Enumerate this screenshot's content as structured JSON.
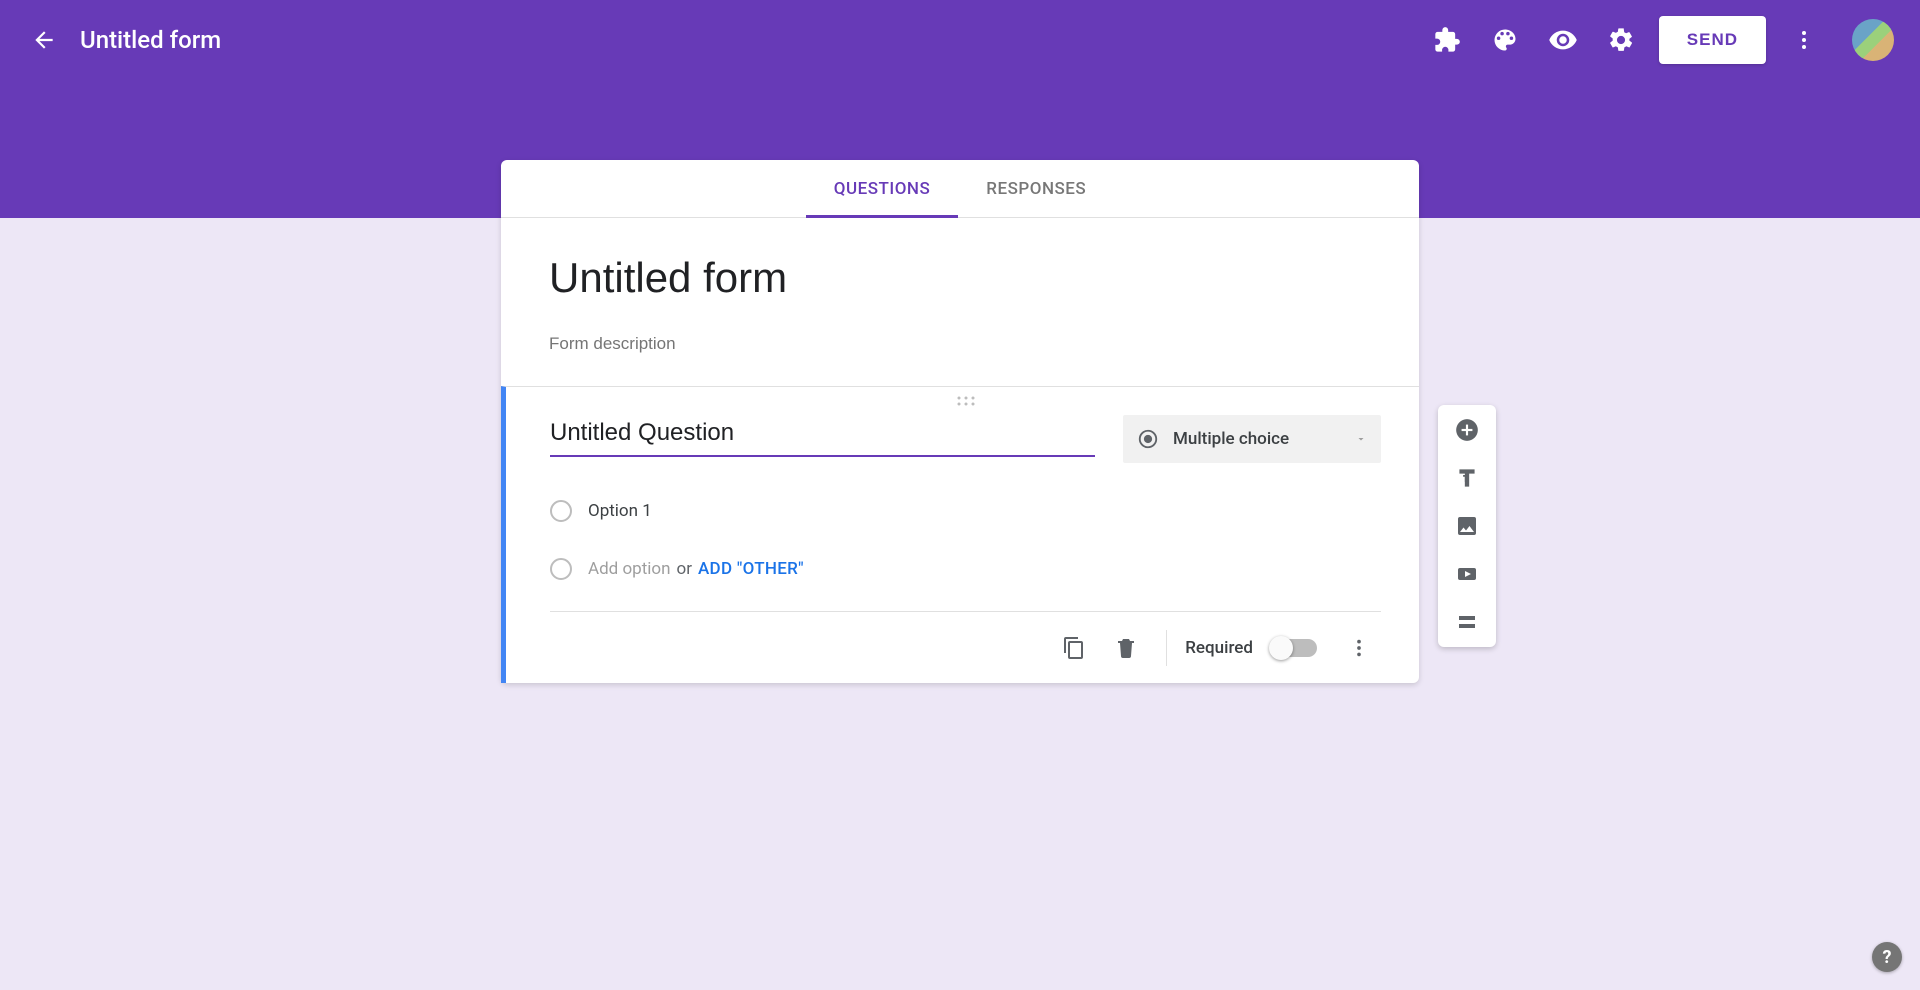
{
  "header": {
    "form_name": "Untitled form",
    "send_label": "SEND"
  },
  "tabs": {
    "questions": "QUESTIONS",
    "responses": "RESPONSES"
  },
  "form": {
    "title": "Untitled form",
    "description_placeholder": "Form description"
  },
  "question": {
    "title": "Untitled Question",
    "type_label": "Multiple choice",
    "options": [
      {
        "label": "Option 1"
      }
    ],
    "add_option_placeholder": "Add option",
    "or_text": "or",
    "add_other_label": "ADD \"OTHER\"",
    "required_label": "Required",
    "required_value": false
  },
  "icons": {
    "back": "arrow-left",
    "addons": "puzzle",
    "palette": "palette",
    "preview": "eye",
    "settings": "gear",
    "more": "more-vert",
    "drag": "drag-handle",
    "type": "radio-filled",
    "dropdown": "caret-down",
    "duplicate": "copy",
    "delete": "trash",
    "toolbar_add": "plus-circle",
    "toolbar_title": "text-size",
    "toolbar_image": "image",
    "toolbar_video": "video",
    "toolbar_section": "section",
    "help": "?"
  }
}
